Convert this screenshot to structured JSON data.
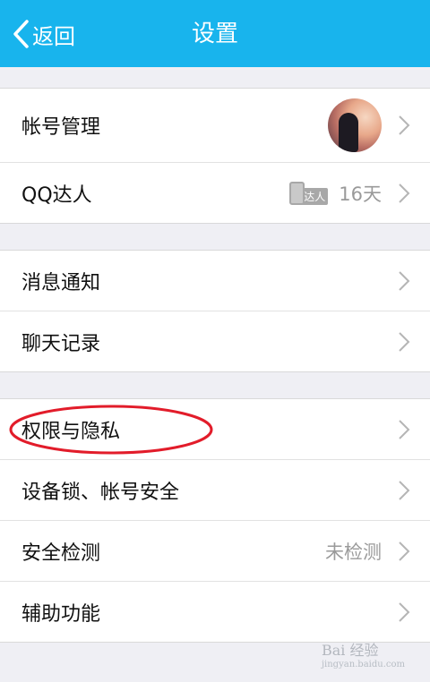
{
  "header": {
    "back_label": "返回",
    "title": "设置",
    "background": "#18b4ed"
  },
  "groups": [
    {
      "items": [
        {
          "label": "帐号管理",
          "right": "avatar"
        },
        {
          "label": "QQ达人",
          "badge": "达人",
          "value": "16天"
        }
      ]
    },
    {
      "items": [
        {
          "label": "消息通知"
        },
        {
          "label": "聊天记录"
        }
      ]
    },
    {
      "items": [
        {
          "label": "权限与隐私",
          "highlighted": true
        },
        {
          "label": "设备锁、帐号安全"
        },
        {
          "label": "安全检测",
          "value": "未检测"
        },
        {
          "label": "辅助功能"
        }
      ]
    }
  ],
  "annotation_color": "#e21c2a",
  "watermark": {
    "text": "Bai 经验",
    "sub": "jingyan.baidu.com"
  }
}
